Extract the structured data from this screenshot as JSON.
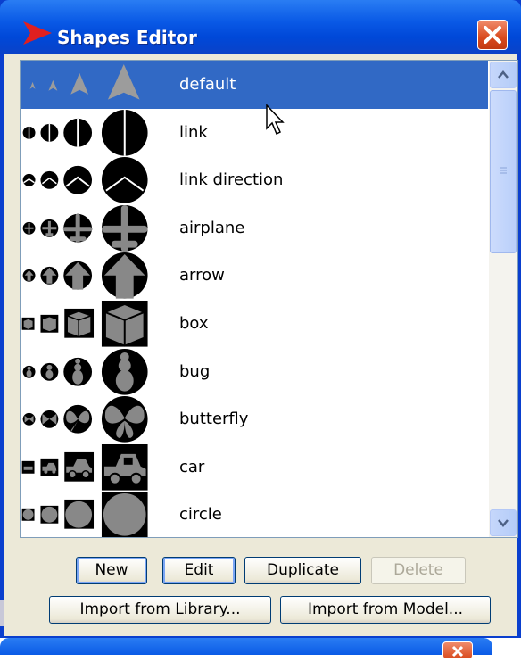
{
  "window": {
    "title": "Shapes Editor",
    "colors": {
      "title_bar": "#0a5ae6",
      "selection": "#3169c5",
      "close_button": "#d94a1e",
      "dialog_bg": "#ece9d8"
    }
  },
  "shapes": [
    {
      "label": "default",
      "icon": "default-arrow-icon",
      "selected": true
    },
    {
      "label": "link",
      "icon": "link-icon",
      "selected": false
    },
    {
      "label": "link direction",
      "icon": "link-direction-icon",
      "selected": false
    },
    {
      "label": "airplane",
      "icon": "airplane-icon",
      "selected": false
    },
    {
      "label": "arrow",
      "icon": "arrow-icon",
      "selected": false
    },
    {
      "label": "box",
      "icon": "box-icon",
      "selected": false
    },
    {
      "label": "bug",
      "icon": "bug-icon",
      "selected": false
    },
    {
      "label": "butterfly",
      "icon": "butterfly-icon",
      "selected": false
    },
    {
      "label": "car",
      "icon": "car-icon",
      "selected": false
    },
    {
      "label": "circle",
      "icon": "circle-icon",
      "selected": false
    }
  ],
  "buttons": {
    "new": "New",
    "edit": "Edit",
    "duplicate": "Duplicate",
    "delete": "Delete",
    "import_library": "Import from Library...",
    "import_model": "Import from Model..."
  }
}
